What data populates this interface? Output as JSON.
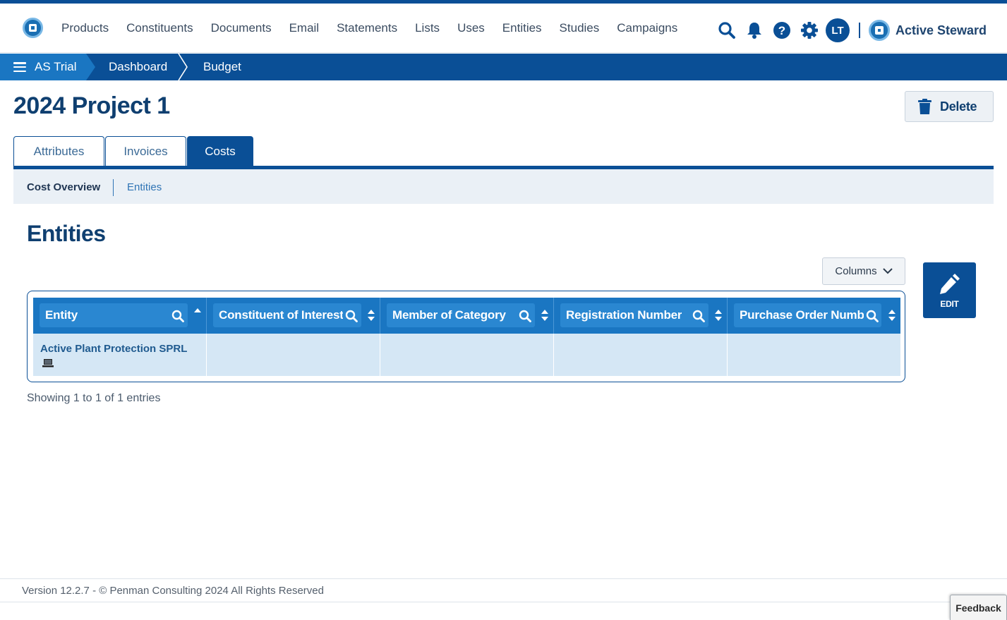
{
  "nav": {
    "links": [
      "Products",
      "Constituents",
      "Documents",
      "Email",
      "Statements",
      "Lists",
      "Uses",
      "Entities",
      "Studies",
      "Campaigns"
    ],
    "avatar_initials": "LT",
    "brand_name": "Active Steward"
  },
  "breadcrumb": {
    "items": [
      "AS Trial",
      "Dashboard",
      "Budget"
    ]
  },
  "page": {
    "title": "2024 Project 1",
    "delete_label": "Delete"
  },
  "tabs": {
    "items": [
      "Attributes",
      "Invoices",
      "Costs"
    ],
    "active": "Costs"
  },
  "subnav": {
    "items": [
      "Cost Overview",
      "Entities"
    ],
    "active": "Cost Overview"
  },
  "section": {
    "title": "Entities",
    "columns_label": "Columns",
    "edit_label": "EDIT"
  },
  "table": {
    "columns": [
      "Entity",
      "Constituent of Interest",
      "Member of Category",
      "Registration Number",
      "Purchase Order Number"
    ],
    "rows": [
      {
        "entity": "Active Plant Protection SPRL",
        "constituent": "",
        "member": "",
        "registration": "",
        "po": ""
      }
    ],
    "showing": "Showing 1 to 1 of 1 entries"
  },
  "footer": {
    "text": "Version 12.2.7 - © Penman Consulting 2024 All Rights Reserved",
    "feedback_label": "Feedback"
  },
  "colors": {
    "primary": "#0a4f96",
    "accent": "#1a76c2",
    "row": "#d5e7f5"
  },
  "icons": [
    "search-icon",
    "bell-icon",
    "help-icon",
    "gear-icon",
    "trash-icon",
    "pencil-icon",
    "chevron-down-icon",
    "sort-icon",
    "laptop-icon",
    "hamburger-icon"
  ]
}
